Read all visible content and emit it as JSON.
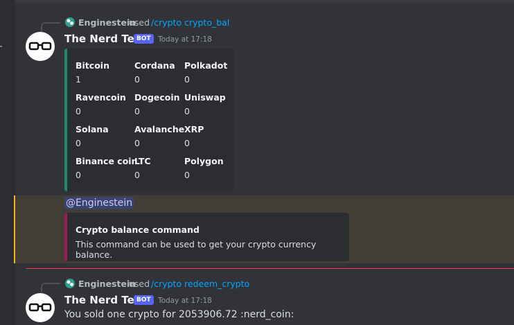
{
  "messages": [
    {
      "invoker": "Enginestein",
      "used_word": "used",
      "command": "/crypto crypto_bal",
      "author": "The Nerd Test",
      "badge": "BOT",
      "timestamp": "Today at 17:18",
      "embed_color": "#1f8b6b",
      "fields": [
        {
          "name": "Bitcoin",
          "value": "1"
        },
        {
          "name": "Cordana",
          "value": "0"
        },
        {
          "name": "Polkadot",
          "value": "0"
        },
        {
          "name": "Ravencoin",
          "value": "0"
        },
        {
          "name": "Dogecoin",
          "value": "0"
        },
        {
          "name": "Uniswap",
          "value": "0"
        },
        {
          "name": "Solana",
          "value": "0"
        },
        {
          "name": "Avalanche",
          "value": "0"
        },
        {
          "name": "XRP",
          "value": "0"
        },
        {
          "name": "Binance coin",
          "value": "0"
        },
        {
          "name": "LTC",
          "value": "0"
        },
        {
          "name": "Polygon",
          "value": "0"
        }
      ]
    },
    {
      "mention": "@Enginestein",
      "embed_color": "#a3195b",
      "embed_title": "Crypto balance command",
      "embed_description": "This command can be used to get your crypto currency balance."
    },
    {
      "invoker": "Enginestein",
      "used_word": "used",
      "command": "/crypto redeem_crypto",
      "author": "The Nerd Test",
      "badge": "BOT",
      "timestamp": "Today at 17:18",
      "text": "You sold one crypto for 2053906.72 :nerd_coin:"
    }
  ],
  "icons": [
    "command-app-icon",
    "glasses-avatar-icon"
  ]
}
